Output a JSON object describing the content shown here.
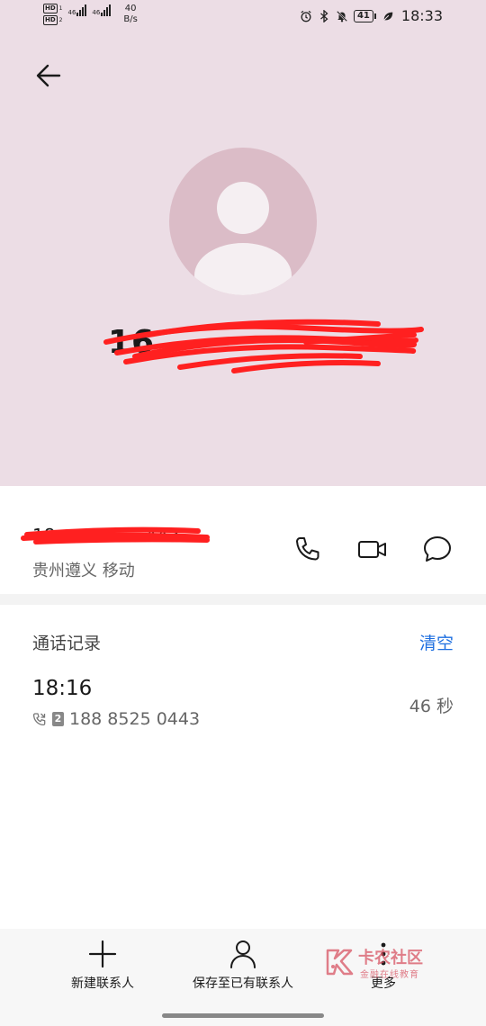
{
  "status_bar": {
    "sim1_network": "46",
    "sim2_network": "46",
    "speed_value": "40",
    "speed_unit": "B/s",
    "battery": "41",
    "time": "18:33",
    "icons": [
      "alarm-icon",
      "bluetooth-icon",
      "mute-icon",
      "battery-icon",
      "leaf-icon"
    ]
  },
  "header": {
    "back_icon": "arrow-left-icon",
    "avatar_icon": "person-icon",
    "number_partial": "16",
    "background": "#ecdde5"
  },
  "info": {
    "number_partial": "18",
    "number_suffix": "443",
    "location": "贵州遵义 移动",
    "actions": [
      "phone-icon",
      "video-call-icon",
      "message-icon"
    ]
  },
  "call_log": {
    "title": "通话记录",
    "clear_label": "清空",
    "entries": [
      {
        "time": "18:16",
        "sim": "2",
        "number": "188 8525 0443",
        "duration": "46 秒"
      }
    ],
    "accent": "#1e6fe0"
  },
  "bottom_bar": {
    "new_contact": "新建联系人",
    "save_existing": "保存至已有联系人",
    "more": "更多"
  },
  "watermark": {
    "title": "卡农社区",
    "subtitle": "金融在线教育"
  }
}
